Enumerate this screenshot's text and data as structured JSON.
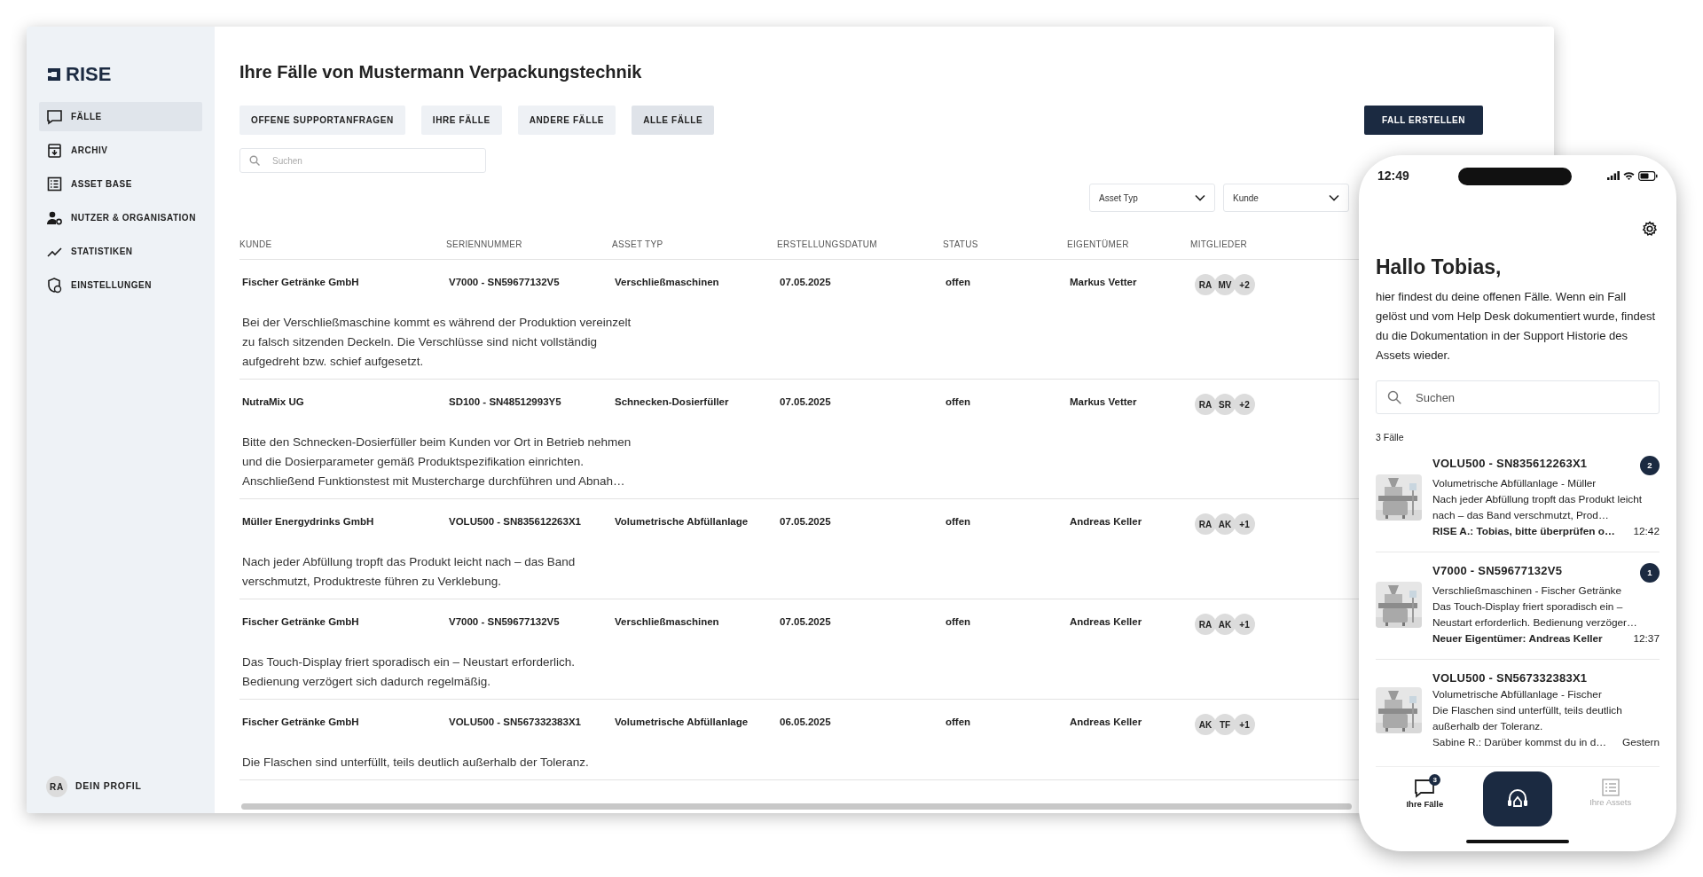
{
  "sidebar": {
    "logo": "RISE",
    "items": [
      {
        "label": "FÄLLE",
        "selected": true
      },
      {
        "label": "ARCHIV",
        "selected": false
      },
      {
        "label": "ASSET BASE",
        "selected": false
      },
      {
        "label": "NUTZER & ORGANISATION",
        "selected": false
      },
      {
        "label": "STATISTIKEN",
        "selected": false
      },
      {
        "label": "EINSTELLUNGEN",
        "selected": false
      }
    ],
    "profile": {
      "initials": "RA",
      "label": "DEIN PROFIL"
    }
  },
  "main": {
    "title": "Ihre Fälle von Mustermann Verpackungstechnik",
    "filters": [
      {
        "label": "OFFENE SUPPORTANFRAGEN",
        "selected": false
      },
      {
        "label": "IHRE FÄLLE",
        "selected": false
      },
      {
        "label": "ANDERE FÄLLE",
        "selected": false
      },
      {
        "label": "ALLE FÄLLE",
        "selected": true
      }
    ],
    "create_button": "FALL ERSTELLEN",
    "search": {
      "placeholder": "Suchen"
    },
    "dropdowns": [
      {
        "placeholder": "Asset Typ"
      },
      {
        "placeholder": "Kunde"
      }
    ],
    "table": {
      "columns": [
        "KUNDE",
        "SERIENNUMMER",
        "ASSET TYP",
        "ERSTELLUNGSDATUM",
        "STATUS",
        "EIGENTÜMER",
        "MITGLIEDER"
      ],
      "rows": [
        {
          "kunde": "Fischer Getränke GmbH",
          "seriennummer": "V7000 - SN59677132V5",
          "asset_typ": "Verschließmaschinen",
          "datum": "07.05.2025",
          "status": "offen",
          "eigentuemer": "Markus Vetter",
          "members": [
            "RA",
            "MV"
          ],
          "more": "+2",
          "description": "Bei der Verschließmaschine kommt es während der Produktion vereinzelt zu falsch sitzenden Deckeln. Die Verschlüsse sind nicht vollständig aufgedreht bzw. schief aufgesetzt."
        },
        {
          "kunde": "NutraMix UG",
          "seriennummer": "SD100 - SN48512993Y5",
          "asset_typ": "Schnecken-Dosierfüller",
          "datum": "07.05.2025",
          "status": "offen",
          "eigentuemer": "Markus Vetter",
          "members": [
            "RA",
            "SR"
          ],
          "more": "+2",
          "description": "Bitte den Schnecken-Dosierfüller beim Kunden vor Ort in Betrieb nehmen und die Dosierparameter gemäß Produktspezifikation einrichten. Anschließend Funktionstest mit Mustercharge durchführen und Abnah…"
        },
        {
          "kunde": "Müller Energydrinks GmbH",
          "seriennummer": "VOLU500 - SN835612263X1",
          "asset_typ": "Volumetrische Abfüllanlage",
          "datum": "07.05.2025",
          "status": "offen",
          "eigentuemer": "Andreas Keller",
          "members": [
            "RA",
            "AK"
          ],
          "more": "+1",
          "description": "Nach jeder Abfüllung tropft das Produkt leicht nach – das Band verschmutzt, Produktreste führen zu Verklebung."
        },
        {
          "kunde": "Fischer Getränke GmbH",
          "seriennummer": "V7000 - SN59677132V5",
          "asset_typ": "Verschließmaschinen",
          "datum": "07.05.2025",
          "status": "offen",
          "eigentuemer": "Andreas Keller",
          "members": [
            "RA",
            "AK"
          ],
          "more": "+1",
          "description": "Das Touch-Display friert sporadisch ein – Neustart erforderlich. Bedienung verzögert sich dadurch regelmäßig."
        },
        {
          "kunde": "Fischer Getränke GmbH",
          "seriennummer": "VOLU500 - SN567332383X1",
          "asset_typ": "Volumetrische Abfüllanlage",
          "datum": "06.05.2025",
          "status": "offen",
          "eigentuemer": "Andreas Keller",
          "members": [
            "AK",
            "TF"
          ],
          "more": "+1",
          "description": "Die Flaschen sind unterfüllt, teils deutlich außerhalb der Toleranz."
        }
      ]
    }
  },
  "phone": {
    "status_time": "12:49",
    "greeting": "Hallo Tobias,",
    "intro": "hier findest du deine offenen Fälle. Wenn ein Fall gelöst und vom Help Desk dokumentiert wurde, findest du die Dokumentation in der Support Historie des Assets wieder.",
    "search": {
      "placeholder": "Suchen"
    },
    "count": "3 Fälle",
    "cases": [
      {
        "title": "VOLU500 - SN835612263X1",
        "subtitle": "Volumetrische Abfüllanlage - Müller",
        "description": "Nach jeder Abfüllung tropft das Produkt leicht nach – das Band verschmutzt, Prod…",
        "message": "RISE A.: Tobias, bitte überprüfen o…",
        "time": "12:42",
        "unread": true,
        "badge": "2"
      },
      {
        "title": "V7000 - SN59677132V5",
        "subtitle": "Verschließmaschinen - Fischer Getränke",
        "description": "Das Touch-Display friert sporadisch ein – Neustart erforderlich. Bedienung verzöger…",
        "message": "Neuer Eigentümer: Andreas Keller",
        "time": "12:37",
        "unread": true,
        "badge": "1"
      },
      {
        "title": "VOLU500 - SN567332383X1",
        "subtitle": "Volumetrische Abfüllanlage - Fischer",
        "description": "Die Flaschen sind unterfüllt, teils deutlich außerhalb der Toleranz.",
        "message": "Sabine R.: Darüber kommst du in d…",
        "time": "Gestern",
        "unread": false
      }
    ],
    "nav": [
      {
        "label": "Ihre Fälle",
        "badge": "3",
        "selected": true
      },
      {
        "label": "Ihre Assets",
        "selected": false
      }
    ]
  }
}
